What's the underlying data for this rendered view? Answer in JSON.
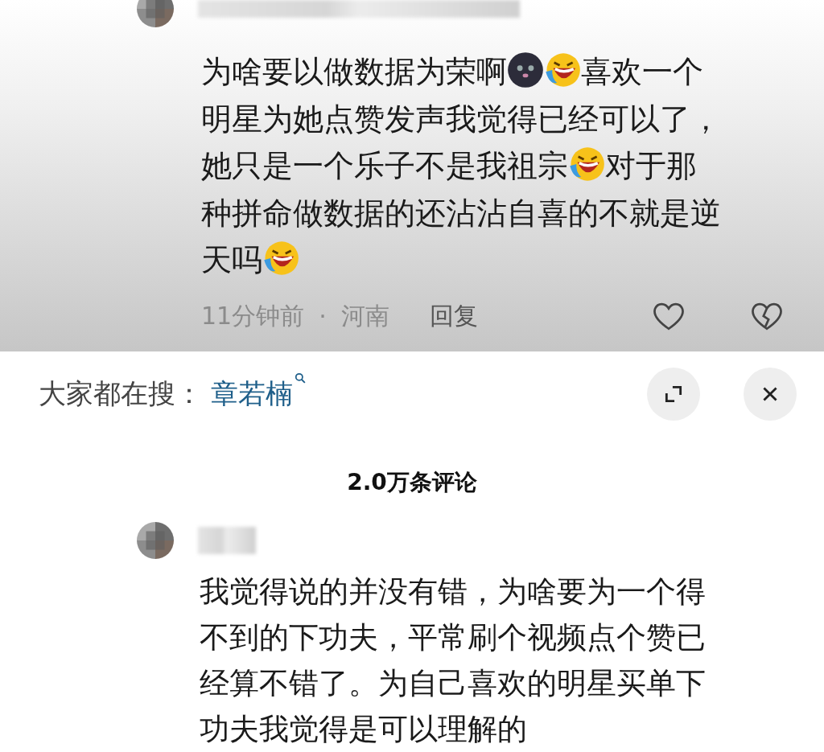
{
  "top_comment": {
    "avatar": {
      "kind": "picture"
    },
    "lines": [
      [
        {
          "kind": "text",
          "text": "为啥要以做数据为荣啊"
        },
        {
          "kind": "emoji-dark"
        },
        {
          "kind": "emoji-laugh"
        },
        {
          "kind": "text",
          "text": "喜欢一个"
        }
      ],
      [
        {
          "kind": "text",
          "text": "明星为她点赞发声我觉得已经可以了，"
        }
      ],
      [
        {
          "kind": "text",
          "text": "她只是一个乐子不是我祖宗"
        },
        {
          "kind": "emoji-laugh"
        },
        {
          "kind": "text",
          "text": "对于那"
        }
      ],
      [
        {
          "kind": "text",
          "text": "种拼命做数据的还沾沾自喜的不就是逆"
        }
      ],
      [
        {
          "kind": "text",
          "text": "天吗"
        },
        {
          "kind": "emoji-laugh"
        }
      ]
    ],
    "time": "11分钟前",
    "separator": "·",
    "location": "河南",
    "reply": "回复"
  },
  "search_bar": {
    "label": "大家都在搜：",
    "query": "章若楠"
  },
  "comment_count": "2.0万条评论",
  "comment": {
    "avatar": {
      "kind": "picture"
    },
    "lines": [
      "我觉得说的并没有错，为啥要为一个得",
      "不到的下功夫，平常刷个视频点个赞已",
      "经算不错了。为自己喜欢的明星买单下",
      "功夫我觉得是可以理解的"
    ]
  }
}
